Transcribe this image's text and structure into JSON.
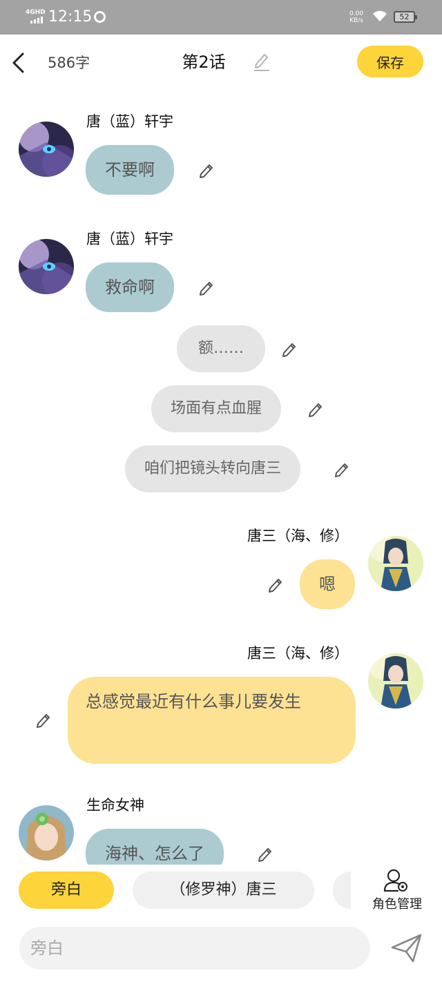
{
  "status_bar": {
    "network": "4GHD",
    "time": "12:15",
    "speed_value": "0.00",
    "speed_unit": "KB/s",
    "battery": "52"
  },
  "header": {
    "word_count": "586字",
    "chapter_title": "第2话",
    "save_label": "保存"
  },
  "messages": [
    {
      "speaker": "唐（蓝）轩宇",
      "text": "不要啊"
    },
    {
      "speaker": "唐（蓝）轩宇",
      "text": "救命啊"
    },
    {
      "text": "额……"
    },
    {
      "text": "场面有点血腥"
    },
    {
      "text": "咱们把镜头转向唐三"
    },
    {
      "speaker": "唐三（海、修）",
      "text": "嗯"
    },
    {
      "speaker": "唐三（海、修）",
      "text": "总感觉最近有什么事儿要发生"
    },
    {
      "speaker": "生命女神",
      "text": "海神、怎么了"
    }
  ],
  "roles": {
    "items": [
      "旁白",
      "（修罗神）唐三"
    ],
    "manage_label": "角色管理"
  },
  "input": {
    "placeholder": "旁白"
  },
  "colors": {
    "accent": "#fdd43a",
    "bubble_left": "#abcbd1",
    "bubble_right": "#fde294",
    "bubble_narration": "#e5e5e5",
    "status_bar": "#a3a3a3"
  }
}
